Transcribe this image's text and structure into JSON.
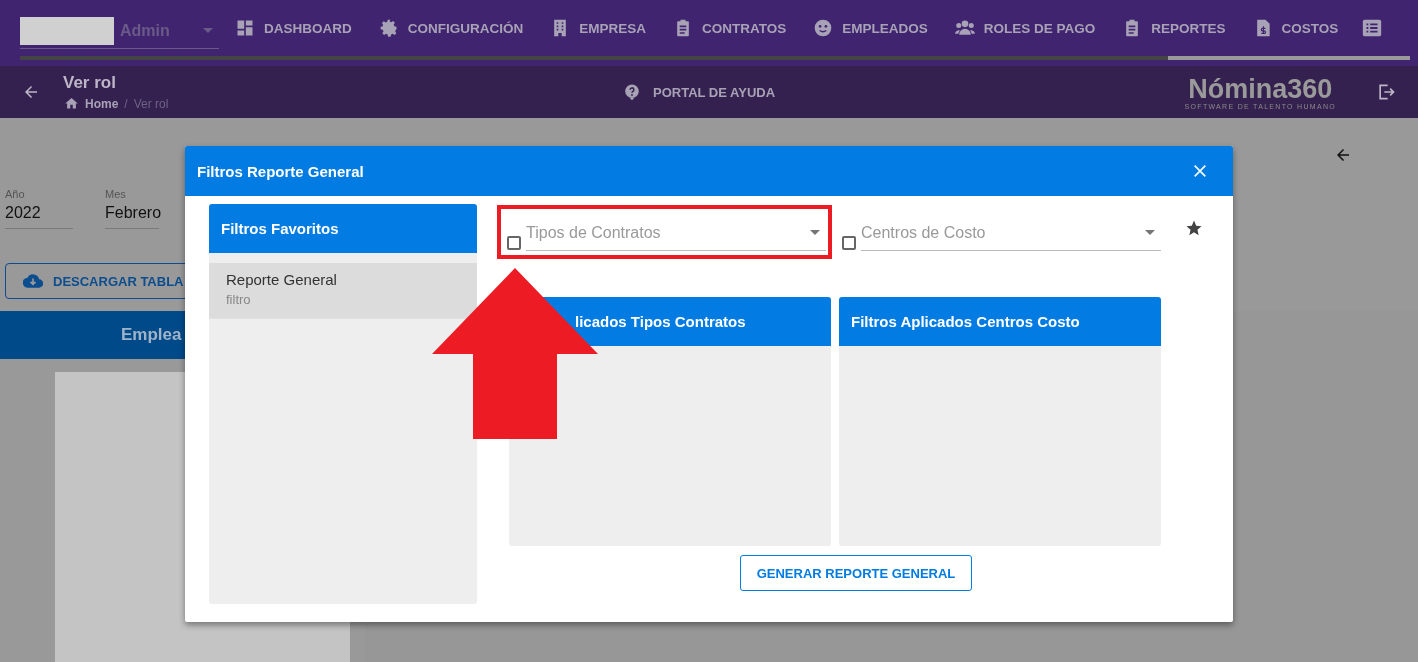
{
  "top_nav": {
    "user_label": "Admin",
    "items": [
      {
        "label": "DASHBOARD"
      },
      {
        "label": "CONFIGURACIÓN"
      },
      {
        "label": "EMPRESA"
      },
      {
        "label": "CONTRATOS"
      },
      {
        "label": "EMPLEADOS"
      },
      {
        "label": "ROLES DE PAGO"
      },
      {
        "label": "REPORTES"
      },
      {
        "label": "COSTOS"
      }
    ]
  },
  "sub_header": {
    "title": "Ver rol",
    "breadcrumb": [
      "Home",
      "Ver rol"
    ],
    "breadcrumb_separator": "/",
    "help_link": "PORTAL DE AYUDA",
    "brand": {
      "name": "Nómina360",
      "tagline": "SOFTWARE DE TALENTO HUMANO"
    }
  },
  "page": {
    "filters": [
      {
        "label": "Año",
        "value": "2022"
      },
      {
        "label": "Mes",
        "value": "Febrero"
      }
    ],
    "download_button": "DESCARGAR TABLA",
    "table_header": "Emplea"
  },
  "dialog": {
    "title": "Filtros Reporte General",
    "favorites": {
      "title": "Filtros Favoritos",
      "items": [
        {
          "name": "Reporte General",
          "subtitle": "filtro",
          "selected": true
        }
      ]
    },
    "selects": [
      {
        "placeholder": "Tipos de Contratos",
        "checked": false,
        "highlighted": true
      },
      {
        "placeholder": "Centros de Costo",
        "checked": false,
        "highlighted": false
      }
    ],
    "applied_panels": [
      {
        "title": "licados Tipos Contratos"
      },
      {
        "title": "Filtros Aplicados Centros Costo"
      }
    ],
    "generate_button": "GENERAR REPORTE GENERAL"
  }
}
